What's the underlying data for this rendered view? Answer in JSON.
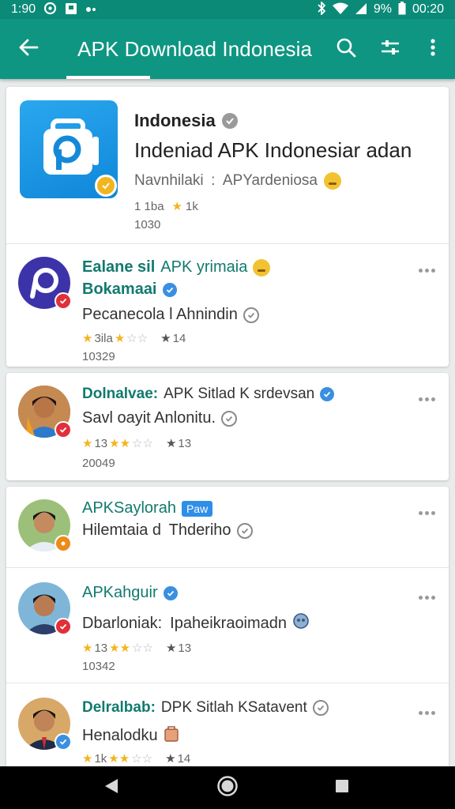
{
  "status_bar": {
    "time_left": "1:90",
    "battery": "9%",
    "time_right": "00:20"
  },
  "app_bar": {
    "title": "APK Download Indonesia"
  },
  "featured": {
    "name": "Indonesia",
    "title": "Indeniad APK Indonesiar adan",
    "subtitle": "Navnhilaki : APYardeniosa",
    "rating_text": "1 1ba",
    "downloads_text": "1k",
    "count": "1030"
  },
  "items": [
    {
      "name_bold": "Ealane sil",
      "name_rest": "APK yrimaia",
      "line2_name": "Bokamaai",
      "line3": "Pecanecola l Ahnindin",
      "rating_text": "3ila",
      "stars_filled": 1,
      "review_text": "14",
      "count": "10329"
    },
    {
      "name_bold": "Dolnalvae:",
      "name_rest": "APK Sitlad K srdevsan",
      "line2": "Savl oayit Anlonitu.",
      "rating_text": "13",
      "stars_filled": 2,
      "review_text": "13",
      "count": "20049"
    },
    {
      "name": "APKSaylorah",
      "tag": "Paw",
      "line2": "Hilemtaia d  Thderiho"
    },
    {
      "name": "APKahguir",
      "line2": "Dbarloniak: Ipaheikraoimadn",
      "rating_text": "13",
      "stars_filled": 2,
      "review_text": "13",
      "count": "10342"
    },
    {
      "name_bold": "Delralbab:",
      "name_rest": "DPK Sitlah KSatavent",
      "line2": "Henalodku",
      "rating_text": "1k",
      "stars_filled": 2,
      "review_text": "14"
    }
  ],
  "colors": {
    "app_bar": "#0f9682",
    "status_bar": "#0b8a78",
    "teal_text": "#117a6e",
    "star": "#f2b51e",
    "badge_red": "#e0303a",
    "badge_orange": "#ee8a1a",
    "badge_blue": "#3a8fe0"
  },
  "icons": [
    "back-arrow-icon",
    "search-icon",
    "filter-icon",
    "overflow-menu-icon",
    "more-icon",
    "star-icon",
    "verified-icon",
    "back-nav-icon",
    "home-nav-icon",
    "recents-nav-icon"
  ]
}
